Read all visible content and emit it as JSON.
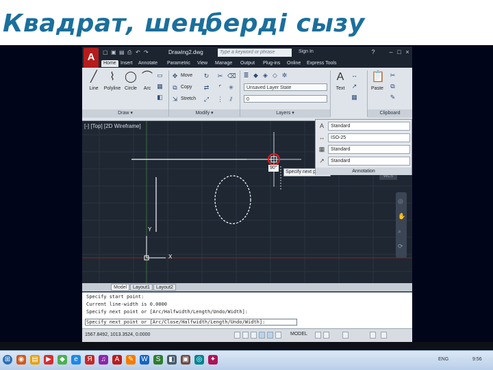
{
  "slide": {
    "title": "Квадрат, шеңберді сызу"
  },
  "autocad": {
    "app_letter": "A",
    "title": "Drawing2.dwg",
    "search_placeholder": "Type a keyword or phrase",
    "signin": "Sign In",
    "tabs": [
      "Home",
      "Insert",
      "Annotate",
      "Parametric",
      "View",
      "Manage",
      "Output",
      "Plug-ins",
      "Online",
      "Express Tools"
    ],
    "draw_tools": [
      "Line",
      "Polyline",
      "Circle",
      "Arc"
    ],
    "modify_tools": [
      "Move",
      "Copy",
      "Stretch"
    ],
    "layer_dropdown_1": "Unsaved Layer State",
    "layer_dropdown_2": "0",
    "text_tool": "Text",
    "paste_tool": "Paste",
    "panels": [
      "Draw ▾",
      "Modify ▾",
      "Layers ▾",
      "Clipboard"
    ],
    "viewport_label": "[-] [Top] [2D Wireframe]",
    "annotation": {
      "rows": [
        "Standard",
        "ISO-25",
        "Standard",
        "Standard"
      ],
      "footer": "Annotation"
    },
    "viewcube_label": "WCS",
    "dynamic_prompt": "Specify next point or",
    "angle": "90°",
    "layout_tabs": [
      "Model",
      "Layout1",
      "Layout2"
    ],
    "command_lines": [
      "Specify start point:",
      "Current line-width is 0.0000",
      "Specify next point or [Arc/Halfwidth/Length/Undo/Width]:",
      "Specify next point or [Arc/Close/Halfwidth/Length/Undo/Width]:"
    ],
    "coordinates": "1567.8492, 1013.3524, 0.0000",
    "model_label": "MODEL",
    "axis_x": "X",
    "axis_y": "Y"
  },
  "taskbar": {
    "lang": "ENG",
    "time": "9:56"
  },
  "colors": {
    "title": "#1b6f9c",
    "slide_bg": "#00051a",
    "canvas": "#1f2733",
    "marker": "#e02020"
  }
}
